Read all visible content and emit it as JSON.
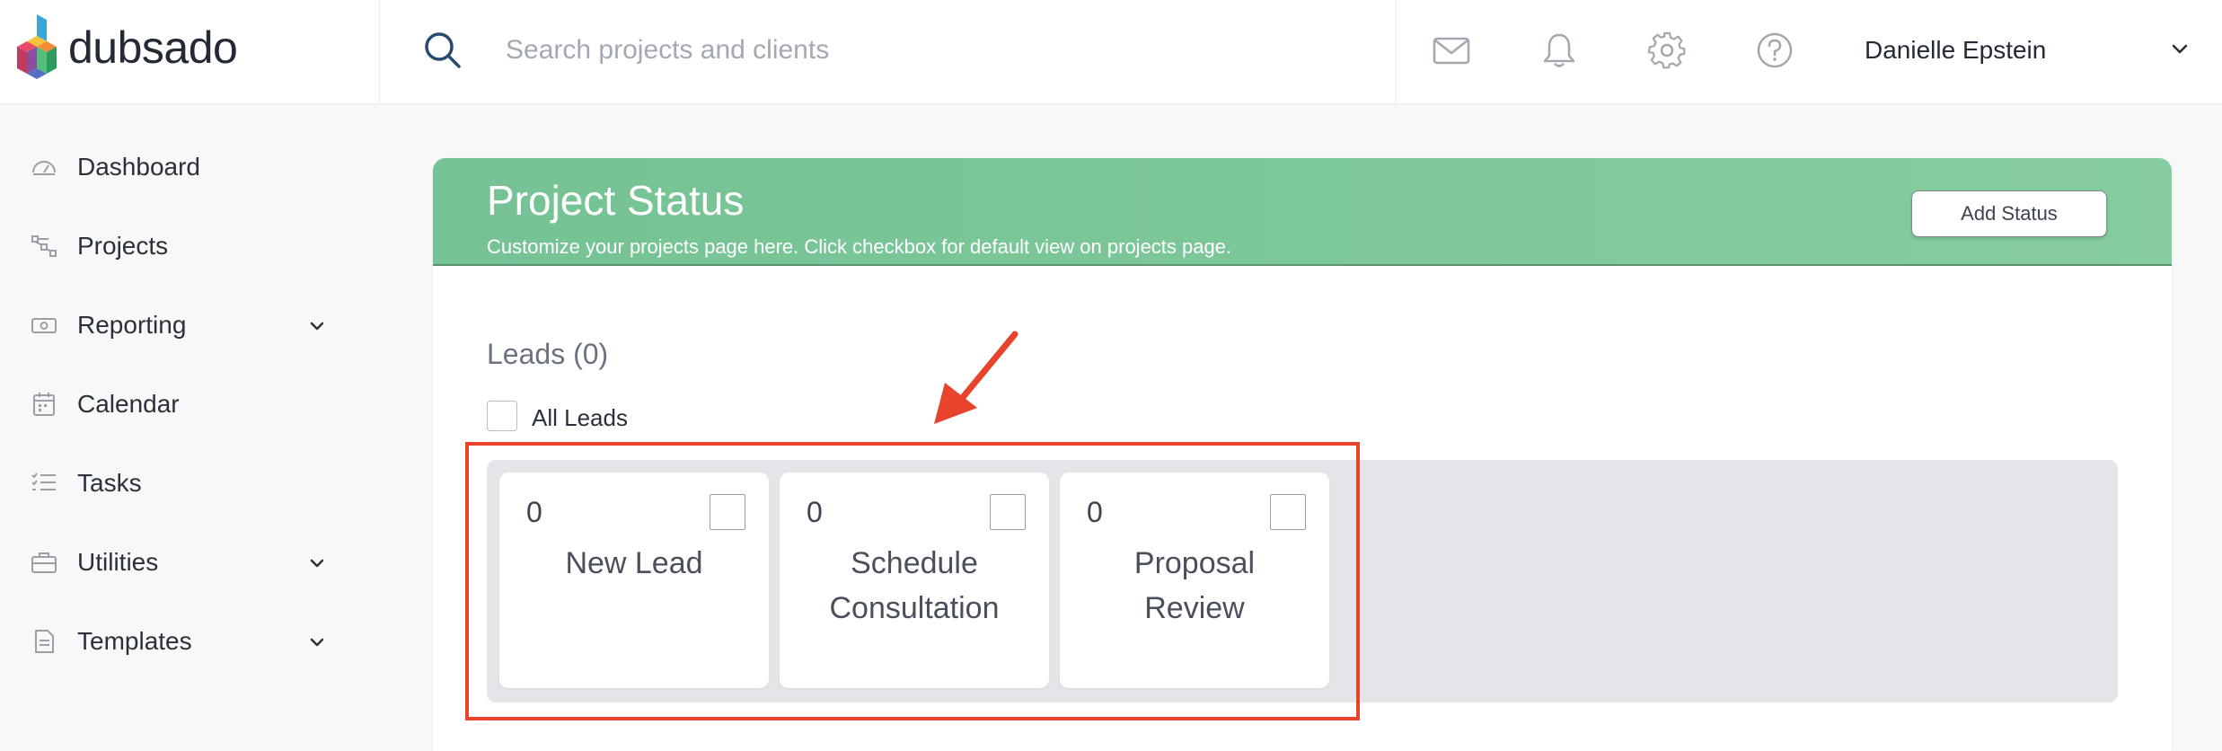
{
  "app": {
    "logo_text": "dubsado"
  },
  "search": {
    "placeholder": "Search projects and clients",
    "value": ""
  },
  "topbar": {
    "icons": [
      "mail-icon",
      "bell-icon",
      "gear-icon",
      "help-icon"
    ],
    "user_name": "Danielle Epstein"
  },
  "sidebar": {
    "items": [
      {
        "label": "Dashboard",
        "icon": "dashboard-icon",
        "has_chevron": false
      },
      {
        "label": "Projects",
        "icon": "projects-icon",
        "has_chevron": false
      },
      {
        "label": "Reporting",
        "icon": "reporting-icon",
        "has_chevron": true
      },
      {
        "label": "Calendar",
        "icon": "calendar-icon",
        "has_chevron": false
      },
      {
        "label": "Tasks",
        "icon": "tasks-icon",
        "has_chevron": false
      },
      {
        "label": "Utilities",
        "icon": "utilities-icon",
        "has_chevron": true
      },
      {
        "label": "Templates",
        "icon": "templates-icon",
        "has_chevron": true
      }
    ]
  },
  "panel": {
    "title": "Project Status",
    "subtitle": "Customize your projects page here. Click checkbox for default view on projects page.",
    "add_status_label": "Add Status",
    "section_title": "Leads (0)",
    "all_leads_label": "All Leads",
    "statuses": [
      {
        "count": "0",
        "label_line1": "New Lead",
        "label_line2": ""
      },
      {
        "count": "0",
        "label_line1": "Schedule",
        "label_line2": "Consultation"
      },
      {
        "count": "0",
        "label_line1": "Proposal",
        "label_line2": "Review"
      }
    ]
  },
  "colors": {
    "header_green": "#7fc99c",
    "annotation_red": "#e8432c",
    "strip_gray": "#e3e5e8"
  }
}
